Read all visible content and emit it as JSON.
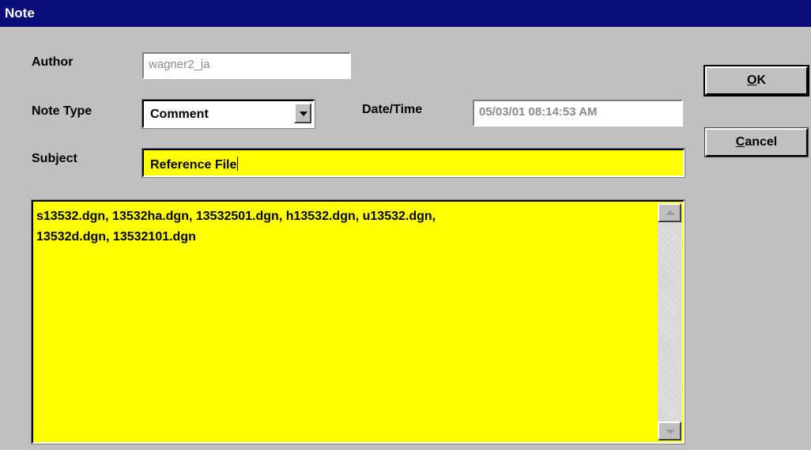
{
  "window": {
    "title": "Note"
  },
  "form": {
    "author_label": "Author",
    "author_value": "wagner2_ja",
    "note_type_label": "Note Type",
    "note_type_value": "Comment",
    "datetime_label": "Date/Time",
    "datetime_value": "05/03/01 08:14:53 AM",
    "subject_label": "Subject",
    "subject_value": "Reference File",
    "body_line1": "s13532.dgn, 13532ha.dgn, 13532501.dgn, h13532.dgn, u13532.dgn,",
    "body_line2": "13532d.dgn, 13532101.dgn"
  },
  "buttons": {
    "ok_mnemonic": "O",
    "ok_rest": "K",
    "cancel_mnemonic": "C",
    "cancel_rest": "ancel"
  },
  "icons": {
    "dropdown": "chevron-down-icon",
    "scroll_up": "scroll-up-arrow-icon",
    "scroll_down": "scroll-down-arrow-icon"
  },
  "colors": {
    "titlebar": "#0b0d7a",
    "dialog_bg": "#c0c0c0",
    "highlight_field": "#ffff00"
  }
}
